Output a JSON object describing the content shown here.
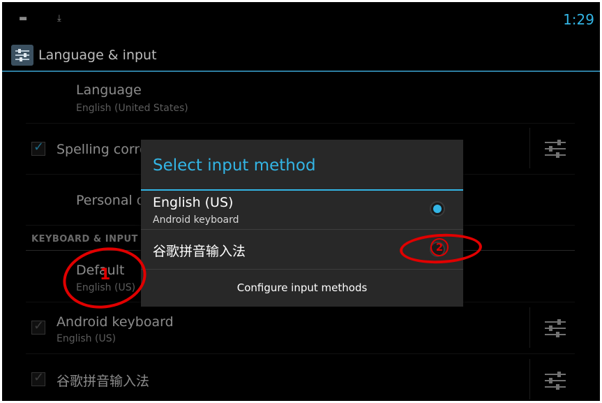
{
  "status_bar": {
    "time": "1:29",
    "icons": [
      "usb-icon",
      "download-icon"
    ]
  },
  "action_bar": {
    "title": "Language & input",
    "icon": "settings-app-icon"
  },
  "settings": {
    "language": {
      "title": "Language",
      "summary": "English (United States)"
    },
    "spelling": {
      "title": "Spelling corre",
      "checked": true
    },
    "personal": {
      "title": "Personal d"
    },
    "section_header": "KEYBOARD & INPUT M",
    "default": {
      "title": "Default",
      "summary": "English (US)"
    },
    "android_keyboard": {
      "title": "Android keyboard",
      "summary": "English (US)",
      "checked": true
    },
    "google_pinyin": {
      "title": "谷歌拼音输入法",
      "checked": true
    }
  },
  "dialog": {
    "title": "Select input method",
    "options": [
      {
        "title": "English (US)",
        "summary": "Android keyboard",
        "selected": true
      },
      {
        "title": "谷歌拼音输入法",
        "summary": "",
        "selected": false
      }
    ],
    "configure_label": "Configure input methods"
  },
  "annotations": {
    "label_1": "1",
    "label_2": "2",
    "color": "#e00000"
  },
  "colors": {
    "accent": "#33b5e5",
    "background": "#000000",
    "dialog": "#282828"
  }
}
